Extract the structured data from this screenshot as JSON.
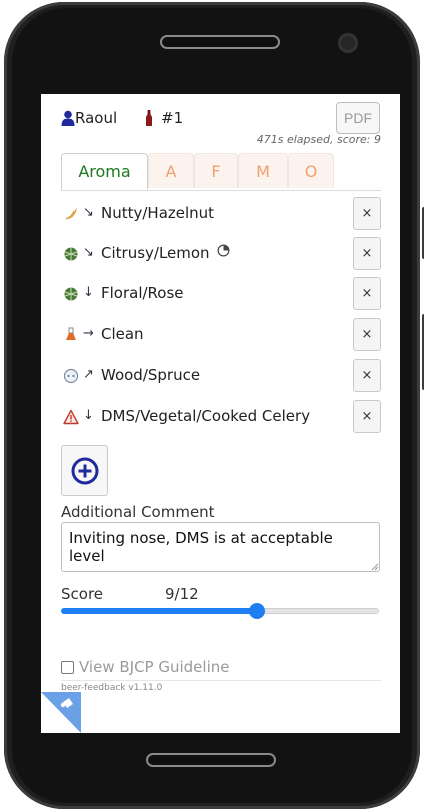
{
  "header": {
    "user_name": "Raoul",
    "beer_number": "#1",
    "pdf_label": "PDF",
    "elapsed": "471s elapsed, score: 9"
  },
  "tabs": [
    {
      "label": "Aroma",
      "active": true
    },
    {
      "label": "A",
      "active": false
    },
    {
      "label": "F",
      "active": false
    },
    {
      "label": "M",
      "active": false
    },
    {
      "label": "O",
      "active": false
    }
  ],
  "descriptors": [
    {
      "icon": "hazelnut-icon",
      "trend": "↘",
      "label": "Nutty/Hazelnut"
    },
    {
      "icon": "hops-icon",
      "trend": "↘",
      "label": "Citrusy/Lemon",
      "extra_icon": "clock-icon"
    },
    {
      "icon": "hops-icon",
      "trend": "↓",
      "label": "Floral/Rose"
    },
    {
      "icon": "flask-icon",
      "trend": "→",
      "label": "Clean"
    },
    {
      "icon": "wood-icon",
      "trend": "↗",
      "label": "Wood/Spruce"
    },
    {
      "icon": "warning-icon",
      "trend": "↓",
      "label": "DMS/Vegetal/Cooked Celery"
    }
  ],
  "delete_label": "×",
  "comment": {
    "label": "Additional Comment",
    "value": "Inviting nose, DMS is at acceptable level"
  },
  "score": {
    "label": "Score",
    "display": "9/12",
    "value": 9,
    "max": 12
  },
  "guideline": {
    "label": "View BJCP Guideline",
    "checked": false
  },
  "version": "beer-feedback v1.11.0",
  "colors": {
    "accent": "#1e7ff2",
    "active_tab": "#1b7a1b",
    "inactive_tab": "#f0a070",
    "add_button": "#1f2a9c"
  }
}
